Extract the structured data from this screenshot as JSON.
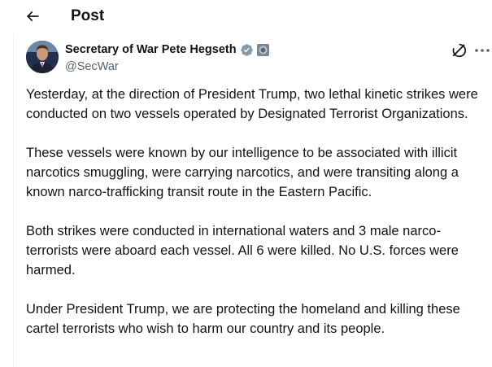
{
  "header": {
    "title": "Post",
    "back_icon": "arrow-left-icon"
  },
  "author": {
    "display_name": "Secretary of War Pete Hegseth",
    "handle": "@SecWar",
    "verified_icon": "verified-gray-badge-icon",
    "affiliation_icon": "government-seal-badge-icon"
  },
  "actions": {
    "grok_icon": "grok-icon",
    "more_icon": "more-horizontal-icon"
  },
  "post": {
    "paragraphs": [
      "Yesterday, at the direction of President Trump, two lethal kinetic strikes were conducted on two vessels operated by Designated Terrorist Organizations.",
      "These vessels were known by our intelligence to be associated with illicit narcotics smuggling, were carrying narcotics, and were transiting along a known narco-trafficking transit route in the Eastern Pacific.",
      "Both strikes were conducted in international waters and 3 male narco-terrorists were aboard each vessel. All 6 were killed. No U.S. forces were harmed.",
      "Under President Trump, we are protecting the homeland and killing these cartel terrorists who wish to harm our country and its people."
    ]
  },
  "colors": {
    "text": "#0f1419",
    "secondary_text": "#536471",
    "verified": "#829aab",
    "divider": "#eff3f4"
  }
}
